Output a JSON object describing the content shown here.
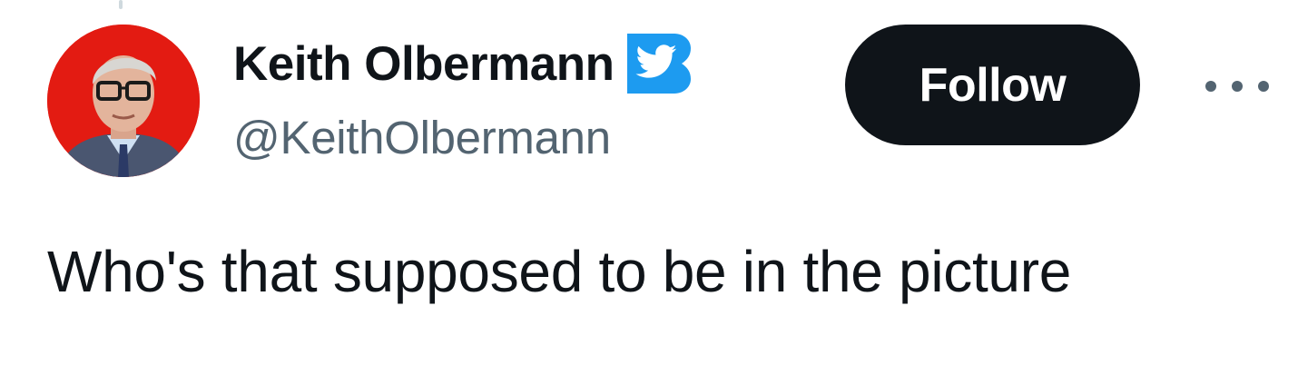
{
  "author": {
    "display_name": "Keith Olbermann",
    "handle": "@KeithOlbermann",
    "avatar": "profile photo of man with glasses on red background",
    "verified_badge": "twitter-bird-badge-icon",
    "badge_color": "#1d9bf0"
  },
  "actions": {
    "follow_label": "Follow",
    "more_icon": "more-dots-icon"
  },
  "tweet": {
    "text": "Who's that supposed to be in the picture"
  },
  "colors": {
    "text_primary": "#0f1419",
    "text_secondary": "#536471",
    "follow_bg": "#0f1419",
    "follow_text": "#ffffff",
    "avatar_bg": "#e31b12"
  }
}
